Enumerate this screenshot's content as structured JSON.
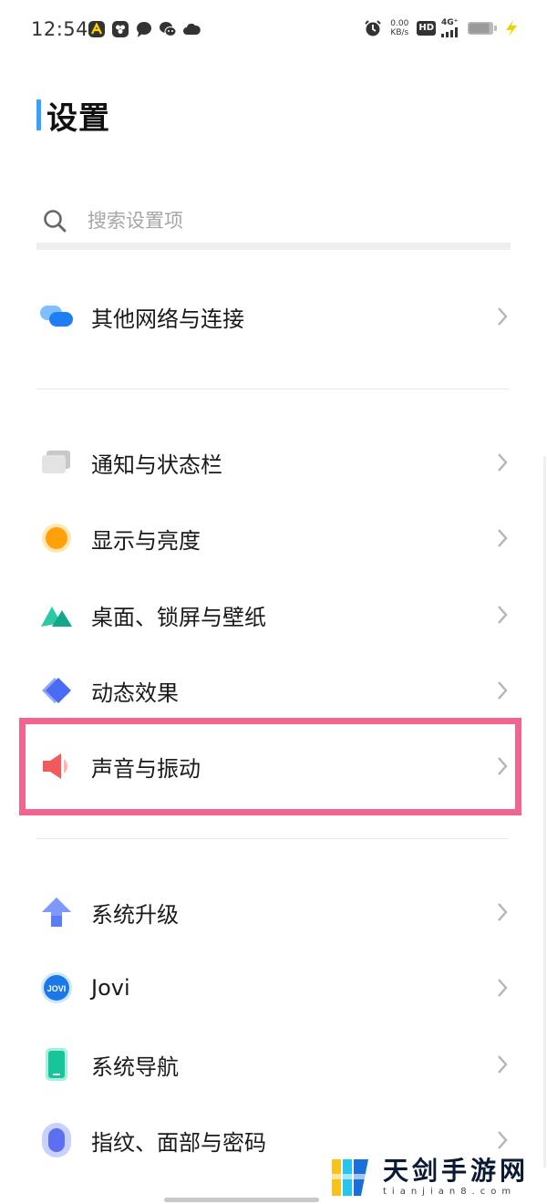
{
  "status_bar": {
    "time": "12:54",
    "net_speed_value": "0.00",
    "net_speed_unit": "KB/s",
    "hd_label": "HD",
    "signal_label": "4G⁺",
    "left_icons": [
      "app-a-icon",
      "gallery-icon",
      "message-icon",
      "wechat-icon",
      "cloud-icon"
    ],
    "right_icons": [
      "alarm-icon",
      "signal-icon",
      "battery-icon",
      "charging-icon"
    ]
  },
  "page": {
    "title": "设置",
    "accent_color": "#3aa0ff"
  },
  "search": {
    "placeholder": "搜索设置项",
    "value": ""
  },
  "groups": [
    {
      "items": [
        {
          "label": "其他网络与连接",
          "icon": "network-connection-icon"
        }
      ]
    },
    {
      "items": [
        {
          "label": "通知与状态栏",
          "icon": "notification-icon"
        },
        {
          "label": "显示与亮度",
          "icon": "display-brightness-icon"
        },
        {
          "label": "桌面、锁屏与壁纸",
          "icon": "wallpaper-icon"
        },
        {
          "label": "动态效果",
          "icon": "animation-icon"
        },
        {
          "label": "声音与振动",
          "icon": "sound-vibration-icon"
        }
      ]
    },
    {
      "items": [
        {
          "label": "系统升级",
          "icon": "system-update-icon"
        },
        {
          "label": "Jovi",
          "icon": "jovi-icon",
          "icon_text": "JOVI"
        },
        {
          "label": "系统导航",
          "icon": "system-navigation-icon"
        },
        {
          "label": "指纹、面部与密码",
          "icon": "fingerprint-face-password-icon"
        }
      ]
    }
  ],
  "highlight": {
    "target": "声音与振动",
    "color": "#f0648e"
  },
  "watermark": {
    "main": "天剑手游网",
    "sub": "tianjian8.com"
  }
}
